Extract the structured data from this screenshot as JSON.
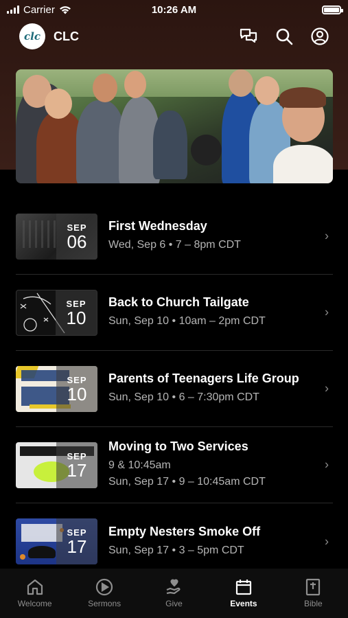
{
  "status": {
    "carrier": "Carrier",
    "time": "10:26 AM"
  },
  "header": {
    "logo_text": "clc",
    "title": "CLC"
  },
  "events": [
    {
      "month": "SEP",
      "day": "06",
      "title": "First Wednesday",
      "lines": [
        "Wed, Sep 6 • 7 – 8pm CDT"
      ],
      "thumb": "first-wednesday"
    },
    {
      "month": "SEP",
      "day": "10",
      "title": "Back to Church Tailgate",
      "lines": [
        "Sun, Sep 10 • 10am – 2pm CDT"
      ],
      "thumb": "tailgate"
    },
    {
      "month": "SEP",
      "day": "10",
      "title": "Parents of Teenagers Life Group",
      "lines": [
        "Sun, Sep 10 • 6 – 7:30pm CDT"
      ],
      "thumb": "parents"
    },
    {
      "month": "SEP",
      "day": "17",
      "title": "Moving to Two Services",
      "lines": [
        "9 & 10:45am",
        "Sun, Sep 17 • 9 – 10:45am CDT"
      ],
      "thumb": "two-services"
    },
    {
      "month": "SEP",
      "day": "17",
      "title": "Empty Nesters Smoke Off",
      "lines": [
        "Sun, Sep 17 • 3 – 5pm CDT"
      ],
      "thumb": "empty-nesters"
    }
  ],
  "tabs": [
    {
      "label": "Welcome",
      "icon": "home-icon"
    },
    {
      "label": "Sermons",
      "icon": "play-icon"
    },
    {
      "label": "Give",
      "icon": "give-icon"
    },
    {
      "label": "Events",
      "icon": "calendar-icon",
      "active": true
    },
    {
      "label": "Bible",
      "icon": "bible-icon"
    }
  ]
}
